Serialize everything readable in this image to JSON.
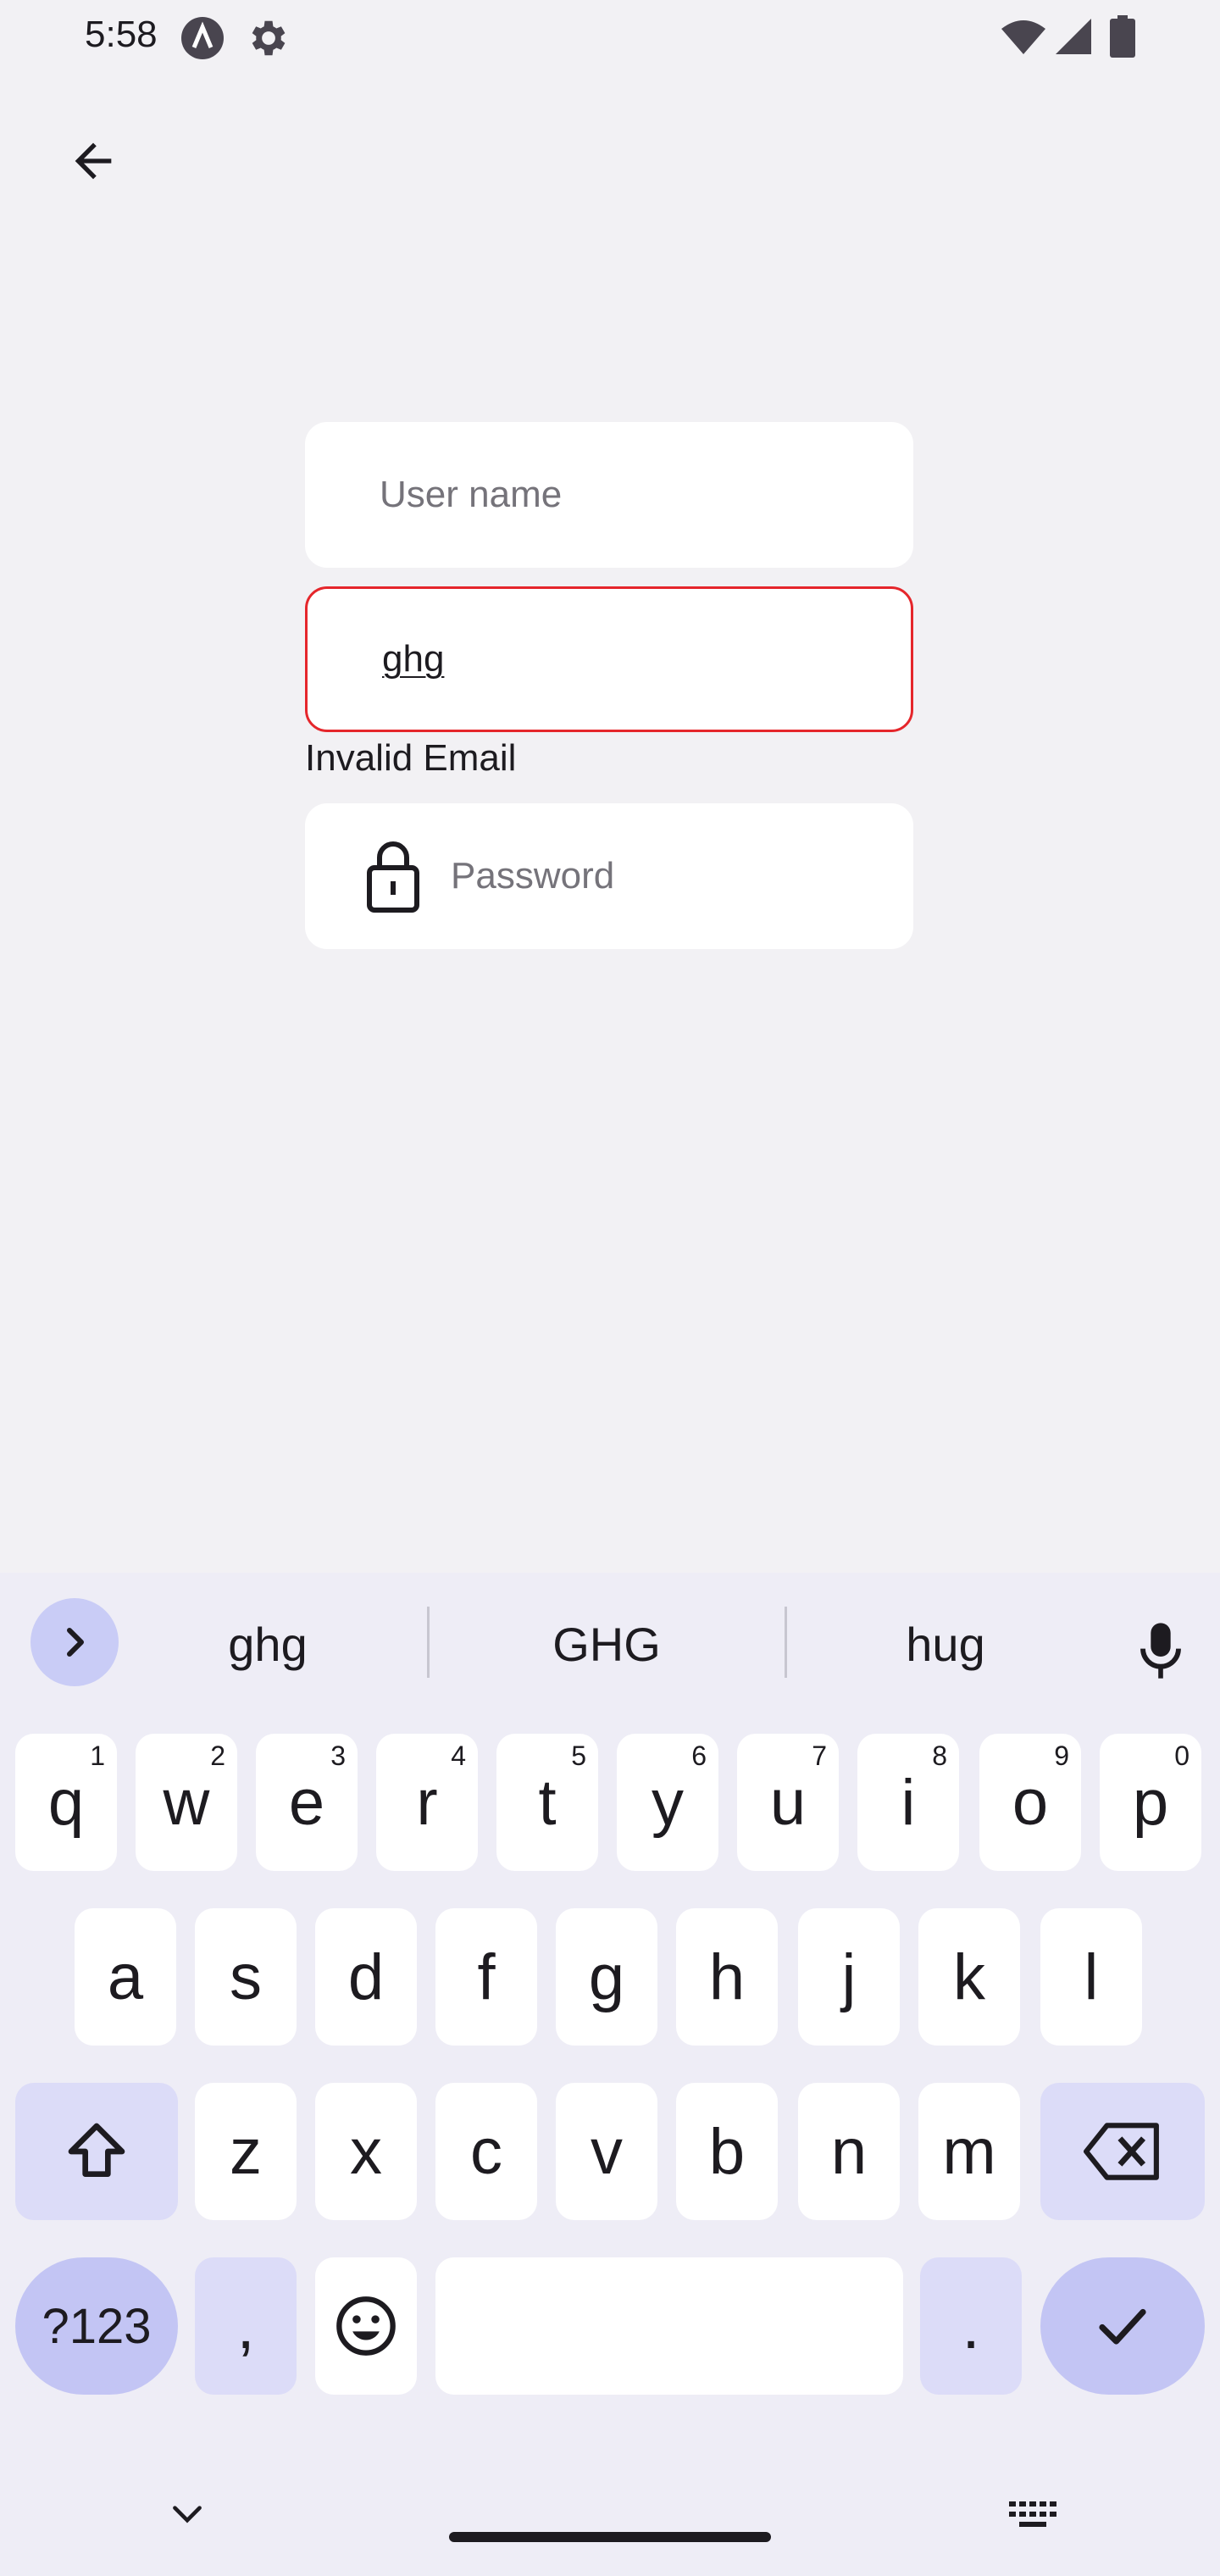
{
  "status_bar": {
    "time": "5:58"
  },
  "form": {
    "username": {
      "placeholder": "User name",
      "value": ""
    },
    "email": {
      "value": "ghg",
      "error": "Invalid Email"
    },
    "password": {
      "placeholder": "Password",
      "value": ""
    }
  },
  "keyboard": {
    "suggestions": [
      "ghg",
      "GHG",
      "hug"
    ],
    "row1": [
      {
        "key": "q",
        "hint": "1"
      },
      {
        "key": "w",
        "hint": "2"
      },
      {
        "key": "e",
        "hint": "3"
      },
      {
        "key": "r",
        "hint": "4"
      },
      {
        "key": "t",
        "hint": "5"
      },
      {
        "key": "y",
        "hint": "6"
      },
      {
        "key": "u",
        "hint": "7"
      },
      {
        "key": "i",
        "hint": "8"
      },
      {
        "key": "o",
        "hint": "9"
      },
      {
        "key": "p",
        "hint": "0"
      }
    ],
    "row2": [
      "a",
      "s",
      "d",
      "f",
      "g",
      "h",
      "j",
      "k",
      "l"
    ],
    "row3": [
      "z",
      "x",
      "c",
      "v",
      "b",
      "n",
      "m"
    ],
    "row4": {
      "symbols": "?123",
      "comma": ",",
      "period": "."
    }
  },
  "colors": {
    "error": "#e5262b",
    "background": "#f2f1f4",
    "keyboard_bg": "#eeedf6",
    "accent_key": "#c3c5f4"
  }
}
